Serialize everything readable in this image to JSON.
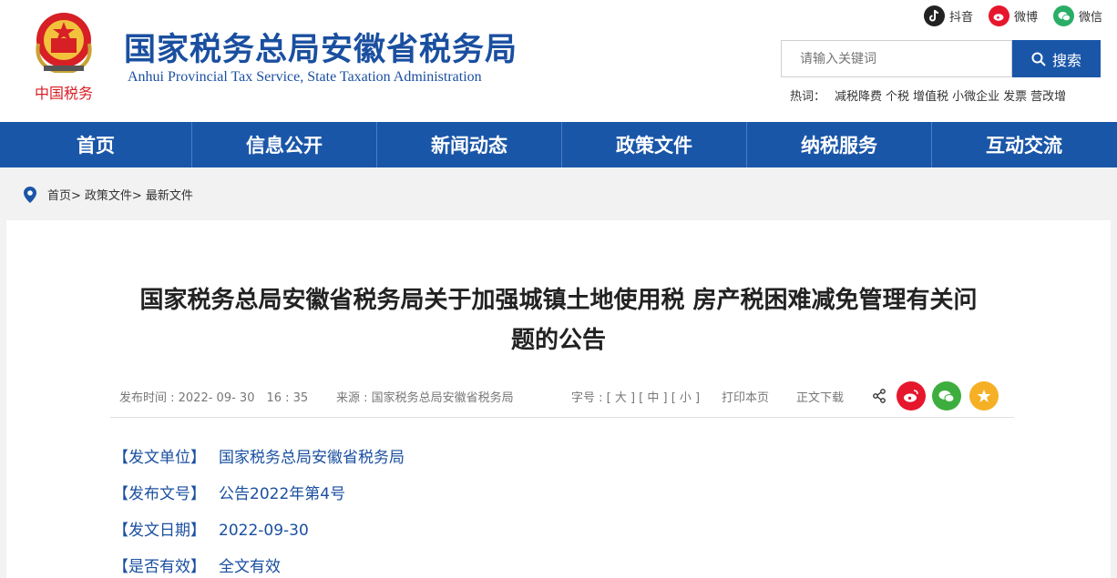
{
  "header": {
    "title": "国家税务总局安徽省税务局",
    "subtitle": "Anhui Provincial Tax Service, State Taxation Administration",
    "logo_text": "中国税务"
  },
  "social": [
    {
      "label": "抖音",
      "icon": "tiktok-icon",
      "color": "#222222"
    },
    {
      "label": "微博",
      "icon": "weibo-icon",
      "color": "#e6162d"
    },
    {
      "label": "微信",
      "icon": "wechat-icon",
      "color": "#2aae67"
    }
  ],
  "search": {
    "placeholder": "请输入关键词",
    "button": "搜索"
  },
  "hot": {
    "label": "热词：",
    "items": [
      "减税降费",
      "个税",
      "增值税",
      "小微企业",
      "发票",
      "营改增"
    ]
  },
  "nav": [
    "首页",
    "信息公开",
    "新闻动态",
    "政策文件",
    "纳税服务",
    "互动交流"
  ],
  "breadcrumb": [
    "首页>",
    "政策文件>",
    "最新文件"
  ],
  "article": {
    "title_line1": "国家税务总局安徽省税务局关于加强城镇土地使用税 房产税困难减免管理有关问",
    "title_line2": "题的公告",
    "publish_time": "发布时间 : 2022- 09- 30　16 : 35",
    "source": "来源 : 国家税务总局安徽省税务局",
    "font_size": "字号 : [ 大 ] [ 中 ] [ 小 ]",
    "print": "打印本页",
    "download": "正文下载",
    "fields": [
      {
        "label": "【发文单位】",
        "value": "国家税务总局安徽省税务局"
      },
      {
        "label": "【发布文号】",
        "value": "公告2022年第4号"
      },
      {
        "label": "【发文日期】",
        "value": "2022-09-30"
      },
      {
        "label": "【是否有效】",
        "value": "全文有效"
      }
    ]
  },
  "colors": {
    "brand": "#1a56a8",
    "title_blue": "#1a4fa0",
    "share_weibo": "#e6162d",
    "share_wechat": "#3dae3d",
    "share_fav": "#f5b025"
  }
}
